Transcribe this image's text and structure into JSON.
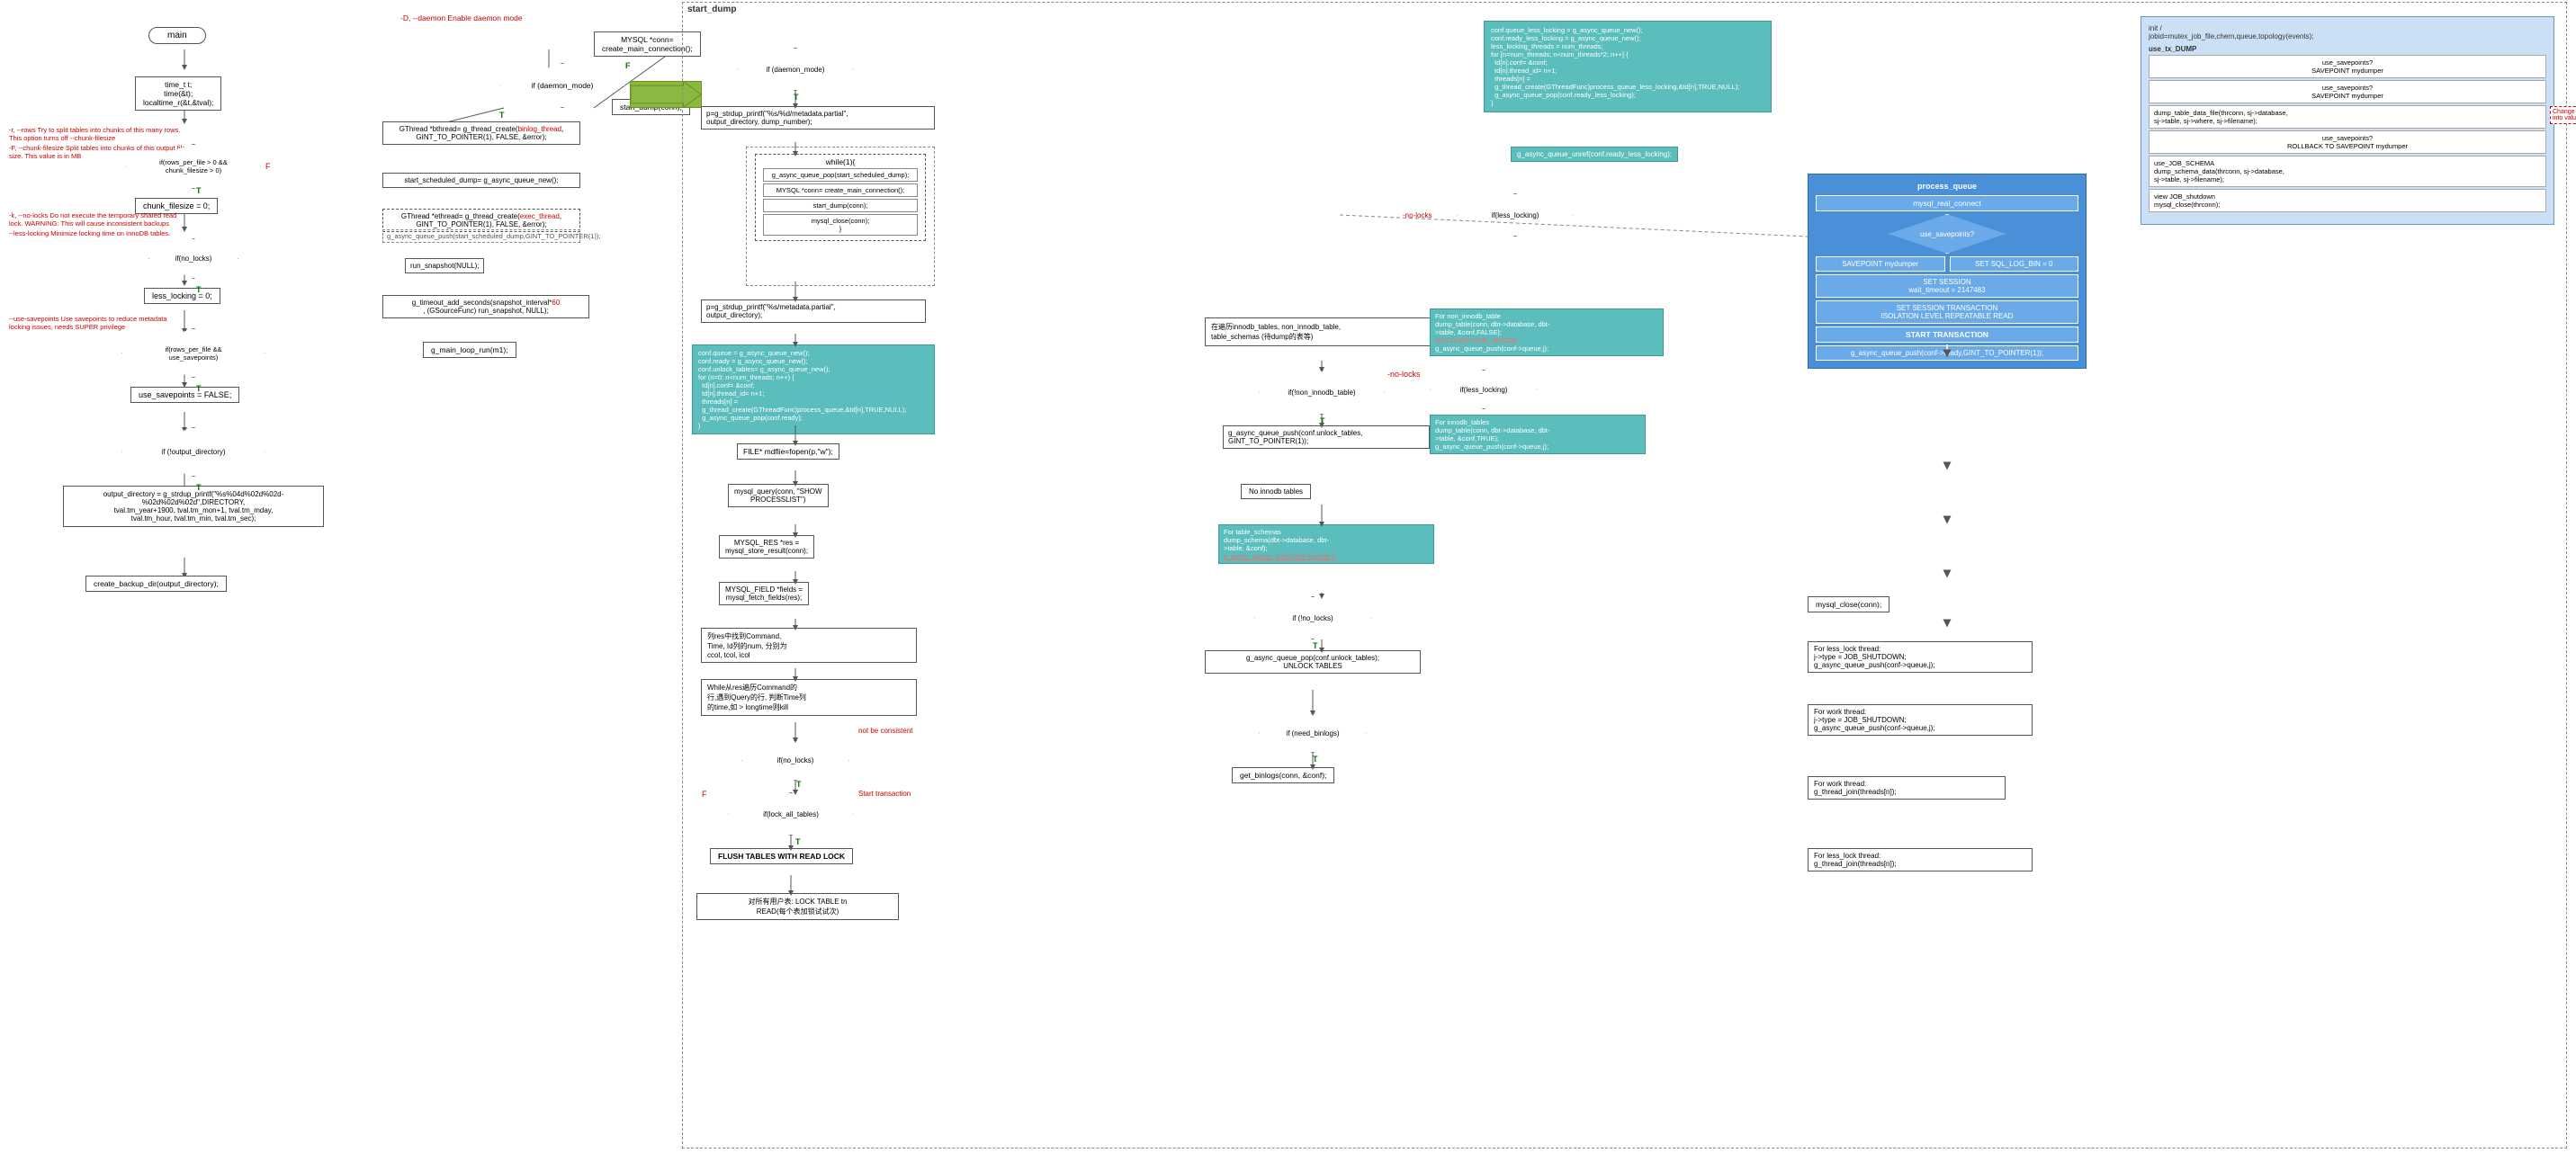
{
  "diagram": {
    "title": "start_dump",
    "left_flowchart": {
      "title": "main",
      "boxes": [
        {
          "id": "main",
          "label": "main",
          "type": "rounded"
        },
        {
          "id": "time_vars",
          "label": "time_t t;\ntime(&t);\nlocaltime_r(&t,&tval);"
        },
        {
          "id": "rows_check",
          "label": "if(rows_per_file > 0 &&\nchunk_filesize > 0)",
          "type": "diamond"
        },
        {
          "id": "chunk_filesize_zero",
          "label": "chunk_filesize = 0;"
        },
        {
          "id": "no_locks_check",
          "label": "if(no_locks)",
          "type": "diamond"
        },
        {
          "id": "less_locking_zero",
          "label": "less_locking = 0;"
        },
        {
          "id": "rows_savepoints",
          "label": "if(rows_per_file &&\nuse_savepoints)",
          "type": "diamond"
        },
        {
          "id": "use_savepoints_false",
          "label": "use_savepoints = FALSE;"
        },
        {
          "id": "output_dir_check",
          "label": "if(!output_directory)",
          "type": "diamond"
        },
        {
          "id": "output_dir_set",
          "label": "output_directory = g_strdup_printf(\"%s%04d%02d%02d-\n%02d%02d%02d\",DIRECTORY,\ntval.tm_year+1900, tval.tm_mon+1, tval.tm_mday,\ntval.tm_hour, tval.tm_min, tval.tm_sec);"
        },
        {
          "id": "create_backup_dir",
          "label": "create_backup_dir(output_directory);"
        }
      ],
      "annotations": [
        {
          "text": "-r, --rows  Try to split tables into chunks of this many rows. This option turns off --chunk-filesize",
          "color": "red"
        },
        {
          "text": "-F, --chunk-filesize  Split tables into chunks of this output file size. This value is in MB",
          "color": "red"
        },
        {
          "text": "-k, --no-locks  Do not execute the temporary shared read lock.  WARNING: This will cause inconsistent backups",
          "color": "red"
        },
        {
          "text": "--less-locking  Minimize locking time on InnoDB tables.",
          "color": "red"
        },
        {
          "text": "--use-savepoints  Use savepoints to reduce metadata locking issues, needs SUPER privilege",
          "color": "red"
        }
      ]
    },
    "middle_flowchart": {
      "annotations": [
        "-D, --daemon  Enable daemon mode"
      ],
      "boxes": [
        {
          "id": "daemon_check",
          "label": "if (daemon_mode)",
          "type": "diamond"
        },
        {
          "id": "gthread_binlog",
          "label": "GThread *bthread= g_thread_create(binlog_thread,\nGINT_TO_POINTER(1), FALSE, &error);"
        },
        {
          "id": "start_scheduled",
          "label": "start_scheduled_dump= g_async_queue_new();"
        },
        {
          "id": "gthread_exec",
          "label": "GThread *ethread= g_thread_create(exec_thread,\nGINT_TO_POINTER(1), FALSE, &error);"
        },
        {
          "id": "run_snapshot",
          "label": "run_snapshot(NULL);"
        },
        {
          "id": "g_timeout",
          "label": "g_timeout_add_seconds(snapshot_interval*60\n, (GSourceFunc) run_snapshot, NULL);"
        },
        {
          "id": "g_main_loop",
          "label": "g_main_loop_run(m1);"
        },
        {
          "id": "mysql_conn",
          "label": "MYSQL *conn=\ncreate_main_connection();"
        },
        {
          "id": "start_dump_conn",
          "label": "start_dump(conn);"
        },
        {
          "id": "start_dump_push",
          "label": "g_async_queue_push(start_scheduled_dump,GINT_TO_POINTER(1));"
        }
      ]
    },
    "right_section": {
      "label": "start_dump",
      "flowchart": {
        "boxes": [
          {
            "id": "daemon_mode2",
            "label": "if (daemon_mode)",
            "type": "diamond"
          },
          {
            "id": "p_strdup",
            "label": "p=g_strdup_printf(\"%s/%d/metadata.partial\",\noutput_directory, dump_number);"
          },
          {
            "id": "while_loop",
            "label": "while(1){"
          },
          {
            "id": "g_async_pop",
            "label": "g_async_queue_pop(start_scheduled_dump);"
          },
          {
            "id": "mysql_conn2",
            "label": "MYSQL *conn= create_main_connection();"
          },
          {
            "id": "start_dump2",
            "label": "start_dump(conn);"
          },
          {
            "id": "mysql_close2",
            "label": "mysql_close(conn);"
          },
          {
            "id": "p_strdup2",
            "label": "p=g_strdup_printf(\"%s/metadata.partial\",\noutput_directory);"
          },
          {
            "id": "conf_queue",
            "label": "conf.queue = g_async_queue_new();\nconf.ready = g_async_queue_new();\nconf.unlock_tables= g_async_queue_new();"
          },
          {
            "id": "for_n_loop",
            "label": "for (n=0; n<num_threads; n++) {\ntd[n].conf= &conf;\ntd[n].thread_id= n+1;\nthreads[n] =\ng_thread_create(GThreadFunc)process_queue,&td[n],TRUE,NULL);\ng_async_queue_pop(conf.ready);\n}"
          },
          {
            "id": "mdflie_fopen",
            "label": "FILE* mdflie=fopen(p,\"w\");"
          },
          {
            "id": "mysql_query_show",
            "label": "mysql_query(conn, \"SHOW\nPROCESSLIST\")"
          },
          {
            "id": "mysql_res",
            "label": "MYSQL_RES *res =\nmysql_store_result(conn);"
          },
          {
            "id": "mysql_fields",
            "label": "MYSQL_FIELD *fields =\nmysql_fetch_fields(res);"
          },
          {
            "id": "while_res",
            "label": "列res中找到Command,\nTime, Id列的num, 分别为\nccol, tcol, icol"
          },
          {
            "id": "while_res2",
            "label": "While从res遍历Command的\n行,遇到Query的行, 判断Time列\n的time,如 > longtime则kill"
          },
          {
            "id": "no_locks_check2",
            "label": "if(no_locks)",
            "type": "diamond"
          },
          {
            "id": "lock_all_tables",
            "label": "if(lock_all_tables)",
            "type": "diamond"
          },
          {
            "id": "flush_tables",
            "label": "FLUSH TABLES WITH READ LOCK"
          },
          {
            "id": "lock_table_read",
            "label": "对所有用户表: LOCK TABLE tn\nREAD(每个表加锁试试次)"
          }
        ]
      },
      "process_queue": {
        "label": "process_queue",
        "boxes": [
          {
            "id": "mysql_real_connect",
            "label": "mysql_real_connect"
          },
          {
            "id": "use_savepoints_check",
            "label": "use_savepoints?",
            "type": "diamond"
          },
          {
            "id": "savepoint_mydumper",
            "label": "SAVEPOINT mydumper"
          },
          {
            "id": "set_sql_log_bin",
            "label": "SET SQL_LOG_BIN = 0"
          },
          {
            "id": "set_session",
            "label": "SET SESSION\nwait_timeout = 2147483"
          },
          {
            "id": "set_session_tx",
            "label": "SET SESSION TRANSACTION\nISOLATION LEVEL REPEATABLE READ"
          },
          {
            "id": "start_transaction",
            "label": "START TRANSACTION"
          },
          {
            "id": "g_async_push_ready",
            "label": "g_async_queue_push(conf->ready,GINT_TO_POINTER(1));"
          }
        ]
      },
      "less_locking_section": {
        "boxes": [
          {
            "id": "conf_queue2",
            "label": "conf.queue_less_locking = g_async_queue_new();\nconf.ready_less_locking = g_async_queue_new();\nless_locking_threads = num_threads;\nfor [n=num_threads; n<num_threads*2; n++] {\ntd[n].conf= &conf;\ntd[n].thread_id= n+1;\nthreads[n] =\ng_thread_create(GThreadFunc)process_queue_less_locking,&td[n],TRUE,NULL);\ng_async_queue_pop(conf.ready_less_locking);\n}"
          },
          {
            "id": "g_async_unref",
            "label": "g_async_queue_unref(conf.ready_less_locking);"
          }
        ]
      },
      "innodb_section": {
        "boxes": [
          {
            "id": "foreach_innodb",
            "label": "在遍历innodb_tables, non_innodb_table,\ntable_schemas (待dump的表等)"
          },
          {
            "id": "non_innodb_check",
            "label": "if(!non_innodb_table)",
            "type": "diamond"
          },
          {
            "id": "less_locking_check2",
            "label": "if(less_locking)",
            "type": "diamond"
          },
          {
            "id": "g_async_push_unlock",
            "label": "g_async_queue_push(conf.unlock_tables,\nGINT_TO_POINTER(1));"
          },
          {
            "id": "no_innodb",
            "label": "No innodb tables"
          },
          {
            "id": "for_innodb_tables",
            "label": "For innodb_tables\ndump_table(conn, dbt->database, dbt-\n>table, &conf,TRUE);\ng_async_queue_push(conf->queue,j);"
          },
          {
            "id": "for_non_innodb",
            "label": "For non_innodb_table\ndump_table(conn, dbt->database, dbt-\n>table, &conf,FALSE);\nASK DUMP NON_INNODB\ng_async_queue_push(conf->queue,j);"
          },
          {
            "id": "for_table_schemas",
            "label": "For table_schemas\ndump_schema(dbt->database, dbt-\n>table, &conf);\ng_async_queue_push(conf->queue,j);"
          },
          {
            "id": "no_locks_check3",
            "label": "if (!no_locks)",
            "type": "diamond"
          },
          {
            "id": "g_async_pop_unlock",
            "label": "g_async_queue_pop(conf.unlock_tables);\nUNLOCK TABLES"
          },
          {
            "id": "need_binlogs",
            "label": "if (need_binlogs)",
            "type": "diamond"
          },
          {
            "id": "get_binlogs",
            "label": "get_binlogs(conn, &conf);"
          }
        ]
      },
      "right_panel": {
        "sections": [
          {
            "label": "init / \njobid=mutex_job_file,chern,queue,topology(events);",
            "items": [
              {
                "label": "use_tx_DUMP",
                "sub": "use_savepoints?\nSAVEPOINT mydumper"
              },
              {
                "label": "use_savepoints?\nSAVEPOINT mydumper"
              },
              {
                "label": "dump_table_data_file(thrconn, sj->database,\nsj->table, sj->where, sj->filename);",
                "note": "Change to map\ninto value"
              },
              {
                "label": "use_savepoints?\nROLLBACK TO SAVEPOINT mydumper"
              },
              {
                "label": "use_JOB_SCHEMA\ndump_schema_data(thrconn, sj->database,\nsj->table, sj->filename);"
              },
              {
                "label": "view JOB_shutdown\nmysql_close(thrconn);"
              }
            ]
          }
        ],
        "thread_sections": [
          {
            "label": "For less_lock thread:\nj->type = JOB_SHUTDOWN;\ng_async_queue_push(conf->queue,j);"
          },
          {
            "label": "For work thread:\nj->type = JOB_SHUTDOWN;\ng_async_queue_push(conf->queue,j);"
          },
          {
            "label": "For work thread:\ng_thread_join(threads[n]);"
          }
        ],
        "close_sections": [
          {
            "label": "mysql_close(conn);"
          },
          {
            "label": "For less_lock thread:\ng_thread_join(threads[n]);"
          }
        ]
      }
    }
  }
}
